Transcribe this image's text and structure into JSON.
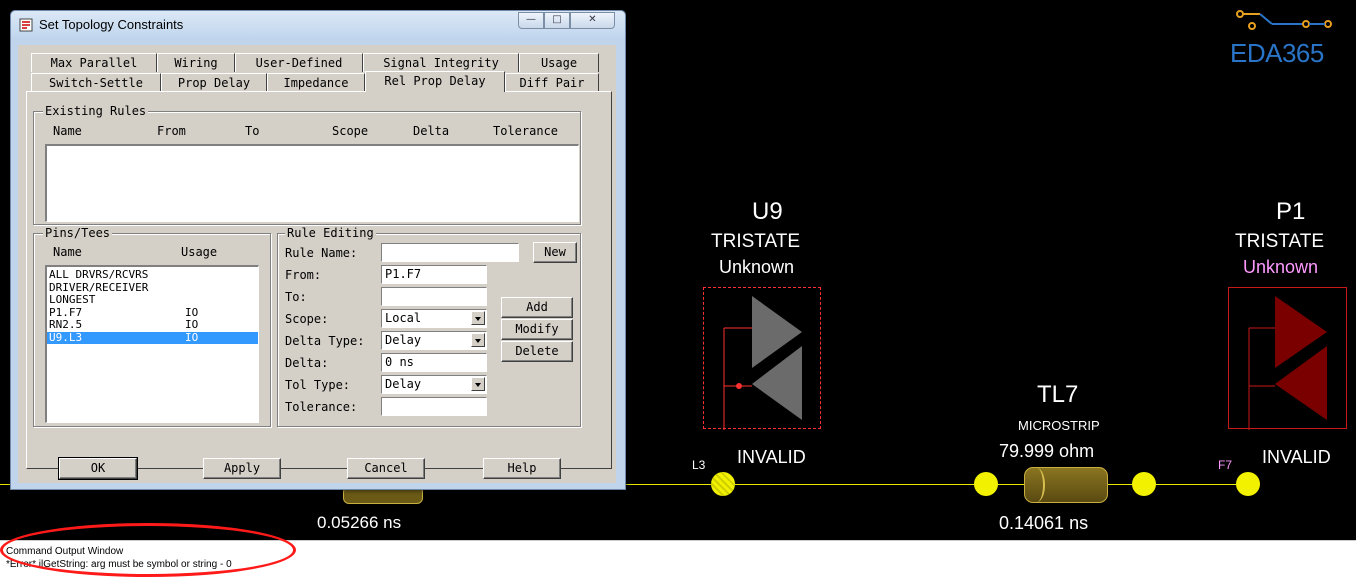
{
  "dialog": {
    "title": "Set Topology Constraints",
    "tabs_row1": [
      "Max Parallel",
      "Wiring",
      "User-Defined",
      "Signal Integrity",
      "Usage"
    ],
    "tabs_row2": [
      "Switch-Settle",
      "Prop Delay",
      "Impedance",
      "Rel Prop Delay",
      "Diff Pair"
    ],
    "active_tab": "Rel Prop Delay",
    "existing_rules": {
      "label": "Existing Rules",
      "columns": [
        "Name",
        "From",
        "To",
        "Scope",
        "Delta",
        "Tolerance"
      ]
    },
    "pins_tees": {
      "label": "Pins/Tees",
      "columns": [
        "Name",
        "Usage"
      ],
      "rows": [
        {
          "name": "ALL DRVRS/RCVRS",
          "usage": ""
        },
        {
          "name": "DRIVER/RECEIVER",
          "usage": ""
        },
        {
          "name": "LONGEST",
          "usage": ""
        },
        {
          "name": "P1.F7",
          "usage": "IO"
        },
        {
          "name": "RN2.5",
          "usage": "IO"
        },
        {
          "name": "U9.L3",
          "usage": "IO"
        }
      ],
      "selected_index": 5
    },
    "rule_editing": {
      "label": "Rule Editing",
      "rule_name_label": "Rule Name:",
      "rule_name_value": "",
      "from_label": "From:",
      "from_value": "P1.F7",
      "to_label": "To:",
      "to_value": "",
      "scope_label": "Scope:",
      "scope_value": "Local",
      "delta_type_label": "Delta Type:",
      "delta_type_value": "Delay",
      "delta_label": "Delta:",
      "delta_value": "0 ns",
      "tol_type_label": "Tol Type:",
      "tol_type_value": "Delay",
      "tolerance_label": "Tolerance:",
      "tolerance_value": "",
      "new_label": "New",
      "add_label": "Add",
      "modify_label": "Modify",
      "delete_label": "Delete"
    },
    "buttons": {
      "ok": "OK",
      "apply": "Apply",
      "cancel": "Cancel",
      "help": "Help"
    }
  },
  "schematic": {
    "u9": {
      "ref": "U9",
      "model": "TRISTATE",
      "state": "Unknown",
      "status": "INVALID",
      "pin": "L3"
    },
    "p1": {
      "ref": "P1",
      "model": "TRISTATE",
      "state": "Unknown",
      "status": "INVALID",
      "pin": "F7"
    },
    "tl7": {
      "ref": "TL7",
      "type": "MICROSTRIP",
      "impedance": "79.999 ohm",
      "delay": "0.14061 ns"
    },
    "tl_left": {
      "delay": "0.05266 ns"
    },
    "colors": {
      "net": "#e8e800",
      "node": "#f2f200",
      "driver_gray": "#6b6b6b",
      "driver_red": "#7a0000",
      "unknown_pink": "#ff99ff"
    }
  },
  "logo": {
    "text": "EDA365",
    "color": "#2a74c8"
  },
  "output": {
    "title": "Command Output Window",
    "message": "*Error* ilGetString: arg must be symbol or string - 0"
  }
}
